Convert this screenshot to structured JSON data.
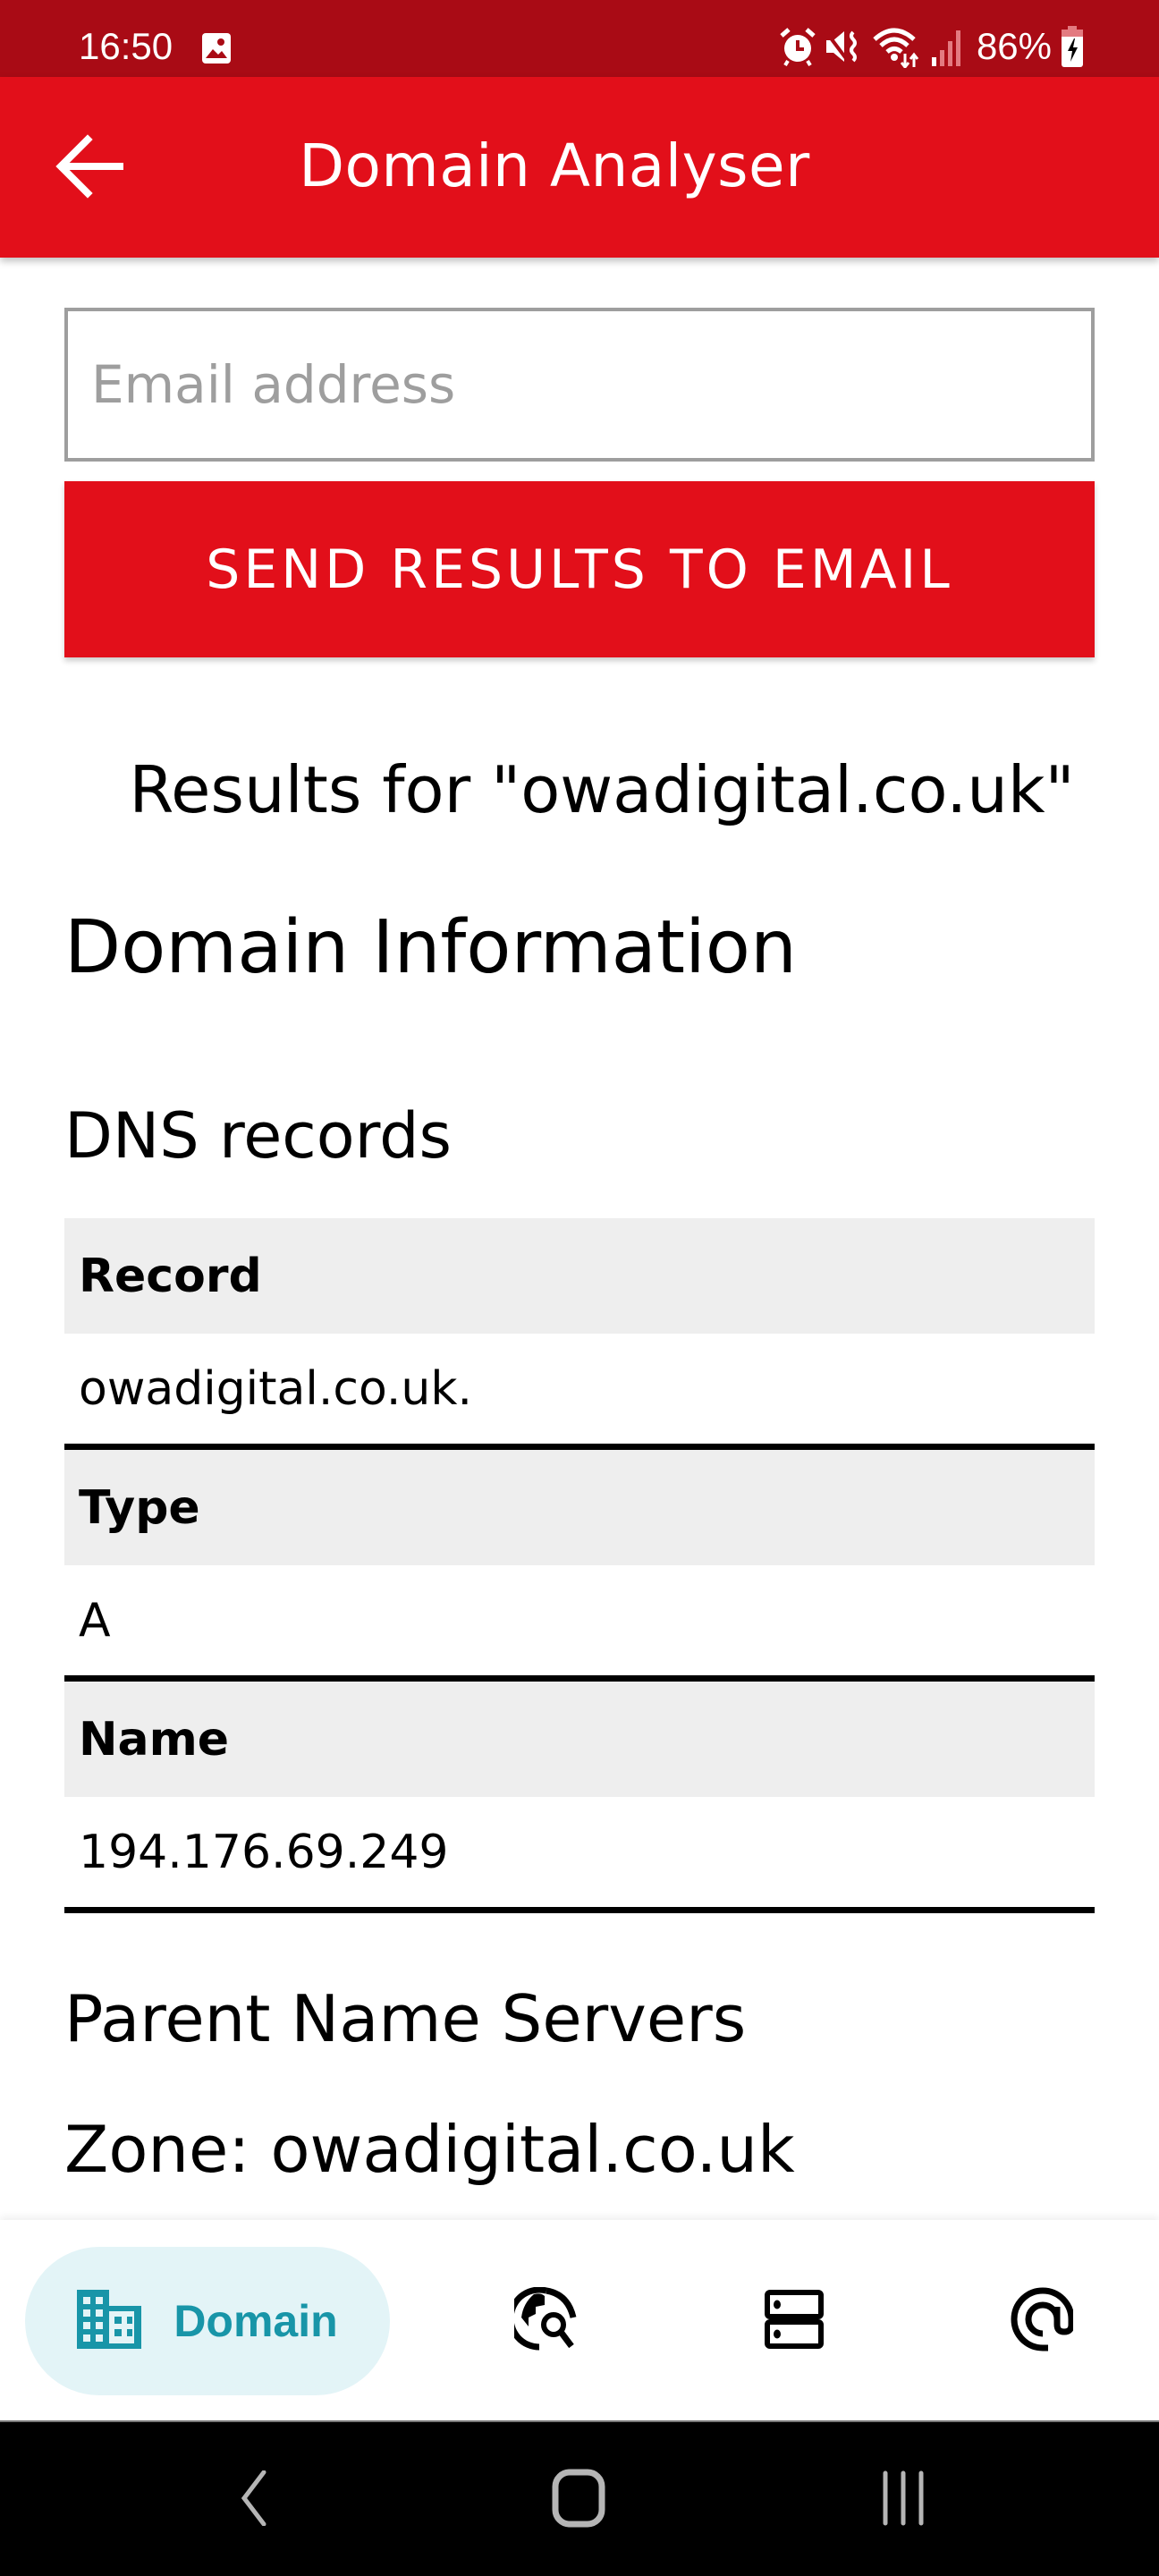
{
  "status_bar": {
    "time": "16:50",
    "battery": "86%",
    "icons": [
      "gallery-icon",
      "alarm-icon",
      "mute-vibrate-icon",
      "wifi-icon",
      "signal-icon",
      "battery-charging-icon"
    ]
  },
  "app_bar": {
    "title": "Domain Analyser",
    "back_icon": "arrow-back-icon"
  },
  "form": {
    "email_placeholder": "Email address",
    "email_value": "",
    "send_label": "SEND RESULTS TO EMAIL"
  },
  "results": {
    "title": "Results for \"owadigital.co.uk\"",
    "section_title": "Domain Information",
    "dns": {
      "title": "DNS records",
      "rows": [
        {
          "header": "Record",
          "value": "owadigital.co.uk."
        },
        {
          "header": "Type",
          "value": "A"
        },
        {
          "header": "Name",
          "value": "194.176.69.249"
        }
      ]
    },
    "parent_name_servers": {
      "title": "Parent Name Servers",
      "zone": "Zone: owadigital.co.uk"
    }
  },
  "bottom_nav": {
    "items": [
      {
        "label": "Domain",
        "icon": "domain-icon",
        "active": true
      },
      {
        "label": "",
        "icon": "travel-explore-icon",
        "active": false
      },
      {
        "label": "",
        "icon": "dns-icon",
        "active": false
      },
      {
        "label": "",
        "icon": "alternate-email-icon",
        "active": false
      }
    ],
    "active_color": "#1895A8",
    "active_bg": "#E3F4F7"
  },
  "colors": {
    "primary": "#E20F1A",
    "status_bar": "#A90B15"
  },
  "system_nav": {
    "buttons": [
      "back",
      "home",
      "recents"
    ]
  }
}
